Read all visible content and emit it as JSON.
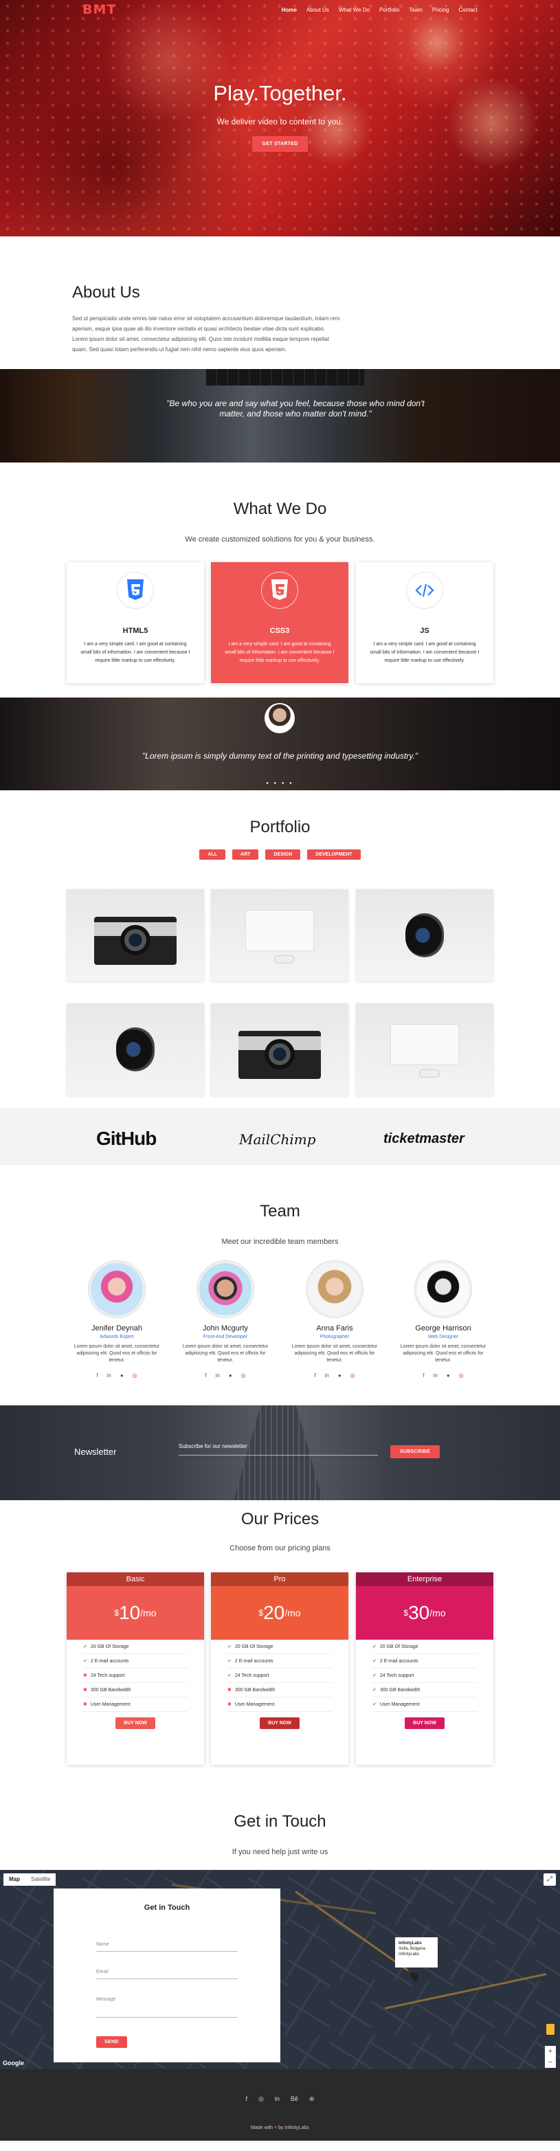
{
  "nav": {
    "logo": "BMT",
    "items": [
      "Home",
      "About Us",
      "What We Do",
      "Portfolio",
      "Team",
      "Pricing",
      "Contact"
    ]
  },
  "hero": {
    "title": "Play.Together.",
    "subtitle": "We deliver video to content to you.",
    "button": "GET STARTED"
  },
  "about": {
    "title": "About Us",
    "text": "Sed ut perspiciatis unde omnis iste natus error sit voluptatem accusantium doloremque laudantium, totam rem aperiam, eaque ipsa quae ab illo inventore veritatis et quasi architecto beatae vitae dicta sunt explicabo. Lorem ipsum dolor sit amet, consectetur adipisicing elit. Quos iste incidunt mollitia eaque tempore repellat quam. Sed quasi totam perferendis ut fugiat rem nihil nemo sapiente eius quos aperiam."
  },
  "quote": {
    "text": "\"Be who you are and say what you feel, because those who mind don't matter, and those who matter don't mind.\""
  },
  "what": {
    "title": "What We Do",
    "subtitle": "We create customized solutions for you & your business.",
    "cards": [
      {
        "title": "HTML5",
        "text": "I am a very simple card. I am good at containing small bits of information. I am convenient because I require little markup to use effectively."
      },
      {
        "title": "CSS3",
        "text": "I am a very simple card. I am good at containing small bits of information. I am convenient because I require little markup to use effectively."
      },
      {
        "title": "JS",
        "text": "I am a very simple card. I am good at containing small bits of information. I am convenient because I require little markup to use effectively."
      }
    ]
  },
  "testimonial": {
    "text": "\"Lorem ipsum is simply dummy text of the printing and typesetting industry.\"",
    "dots": "● ● ● ●"
  },
  "portfolio": {
    "title": "Portfolio",
    "filters": [
      "ALL",
      "ART",
      "DESIGN",
      "DEVELOPMENT"
    ]
  },
  "clients": [
    "GitHub",
    "MailChimp",
    "ticketmaster"
  ],
  "team": {
    "title": "Team",
    "subtitle": "Meet our incredible team members",
    "members": [
      {
        "name": "Jenifer Deynah",
        "role": "Adwords Expert",
        "text": "Lorem ipsum dolor sit amet, consectetur adipisicing elit. Quod eos et officiis for tenetur."
      },
      {
        "name": "John Mcgurty",
        "role": "Front-end Developer",
        "text": "Lorem ipsum dolor sit amet, consectetur adipisicing elit. Quod eos et officiis for tenetur."
      },
      {
        "name": "Anna Faris",
        "role": "Photographer",
        "text": "Lorem ipsum dolor sit amet, consectetur adipisicing elit. Quod eos et officiis for tenetur."
      },
      {
        "name": "George Harrison",
        "role": "Web Designer",
        "text": "Lorem ipsum dolor sit amet, consectetur adipisicing elit. Quod eos et officiis for tenetur."
      }
    ]
  },
  "newsletter": {
    "title": "Newsletter",
    "label": "Subscribe for our newsletter",
    "button": "SUBSCRIBE"
  },
  "prices": {
    "title": "Our Prices",
    "subtitle": "Choose from our pricing plans",
    "plans": [
      {
        "name": "Basic",
        "price": "10",
        "unit": "/mo",
        "color": "#ee5a52",
        "dark": "#b73a33",
        "button": "BUY NOW",
        "features": [
          "20 GB Of Storage",
          "2 E-mail accounts",
          "24 Tech support",
          "300 GB Bandwidth",
          "User Management"
        ]
      },
      {
        "name": "Pro",
        "price": "20",
        "unit": "/mo",
        "color": "#ef5b3a",
        "dark": "#b8402a",
        "button": "BUY NOW",
        "features": [
          "20 GB Of Storage",
          "2 E-mail accounts",
          "24 Tech support",
          "300 GB Bandwidth",
          "User Management"
        ]
      },
      {
        "name": "Enterprise",
        "price": "30",
        "unit": "/mo",
        "color": "#d81b60",
        "dark": "#9e1446",
        "button": "BUY NOW",
        "features": [
          "20 GB Of Storage",
          "2 E-mail accounts",
          "24 Tech support",
          "300 GB Bandwidth",
          "User Management"
        ]
      }
    ]
  },
  "contact": {
    "title": "Get in Touch",
    "subtitle": "If you need help just write us"
  },
  "map": {
    "tab_map": "Map",
    "tab_satellite": "Satellite",
    "form_title": "Get in Touch",
    "name": "Name",
    "email": "Email",
    "message": "Message",
    "send": "SEND",
    "popup_line1": "InfinityLabs",
    "popup_line2": "Sofia, Bulgaria",
    "popup_line3": "InfinityLabs",
    "google": "Google"
  },
  "footer": {
    "made_prefix": "Made with",
    "made_suffix": "by InfinityLabs"
  }
}
